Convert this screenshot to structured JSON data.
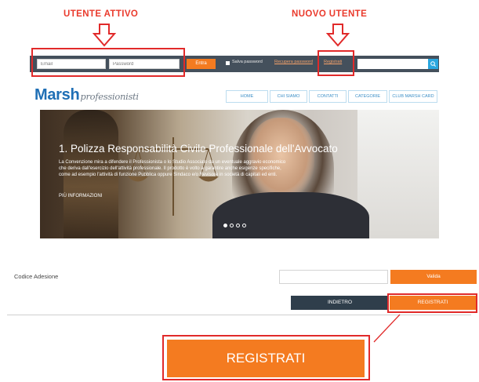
{
  "annotations": {
    "active_user": "UTENTE ATTIVO",
    "new_user": "NUOVO UTENTE"
  },
  "topbar": {
    "email_placeholder": "Email",
    "password_placeholder": "Password",
    "login_button": "Entra",
    "remember_label": "Salva password",
    "recover_link": "Recupera password",
    "register_link": "Registrati",
    "search_placeholder": ""
  },
  "brand": {
    "name": "Marsh",
    "tagline": "professionisti",
    "color": "#1f6fb5"
  },
  "nav": {
    "items": [
      "HOME",
      "CHI SIAMO",
      "CONTATTI",
      "CATEGORIE",
      "CLUB MARSH CARD"
    ]
  },
  "hero": {
    "title": "1. Polizza Responsabilità Civile Professionale dell'Avvocato",
    "text": "La Convenzione mira a difendere il Professionista o lo Studio Associato da un eventuale aggravio economico che deriva dall'esercizio dell'attività professionale. Il prodotto è volto a garantire anche esigenze specifiche, come ad esempio l'attività di funzione Pubblica oppure Sindaco e/o Revisore in società di capitali ed enti.",
    "more_link": "PIÙ INFORMAZIONI",
    "slides_total": 4,
    "active_slide": 1
  },
  "form": {
    "code_label": "Codice Adesione",
    "code_value": "",
    "validate_button": "Valida",
    "back_button": "INDIETRO",
    "register_button": "REGISTRATI"
  },
  "zoom": {
    "register_button": "REGISTRATI"
  },
  "colors": {
    "accent": "#f47b20",
    "topbar": "#44505c",
    "highlight": "#e12a2a",
    "dark_button": "#2f3e4b"
  }
}
